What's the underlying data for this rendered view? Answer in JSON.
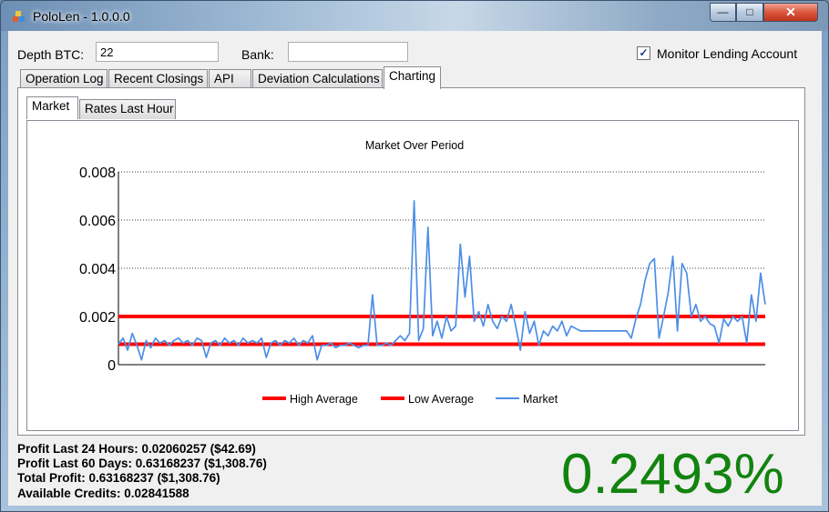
{
  "window": {
    "title": "PoloLen - 1.0.0.0"
  },
  "caption_buttons": {
    "minimize": "—",
    "maximize": "□",
    "close": "✕"
  },
  "form": {
    "depth_label": "Depth BTC:",
    "depth_value": "22",
    "bank_label": "Bank:",
    "bank_value": "",
    "monitor_label": "Monitor Lending Account",
    "monitor_checked": true
  },
  "tabs": [
    "Operation Log",
    "Recent Closings",
    "API",
    "Deviation Calculations",
    "Charting"
  ],
  "active_tab": "Charting",
  "subtabs": [
    "Market",
    "Rates Last Hour"
  ],
  "active_subtab": "Market",
  "chart_data": {
    "type": "line",
    "title": "Market Over Period",
    "xlabel": "",
    "ylabel": "",
    "ylim": [
      0,
      0.008
    ],
    "yticks": [
      "0.008",
      "0.006",
      "0.004",
      "0.002",
      "0"
    ],
    "grid": "horizontal dotted",
    "legend_position": "bottom",
    "series": [
      {
        "name": "High Average",
        "color": "#ff0000",
        "values": [
          0.002,
          0.002
        ]
      },
      {
        "name": "Low Average",
        "color": "#ff0000",
        "values": [
          0.00085,
          0.00085
        ]
      },
      {
        "name": "Market",
        "color": "#4d8ee6",
        "values": [
          0.00085,
          0.0011,
          0.0006,
          0.0013,
          0.0008,
          0.0002,
          0.001,
          0.0007,
          0.0011,
          0.0009,
          0.001,
          0.0008,
          0.001,
          0.0011,
          0.0009,
          0.001,
          0.0008,
          0.0011,
          0.001,
          0.0003,
          0.0009,
          0.001,
          0.0008,
          0.0011,
          0.0009,
          0.001,
          0.0008,
          0.0011,
          0.0009,
          0.001,
          0.0009,
          0.0011,
          0.0003,
          0.0009,
          0.001,
          0.0008,
          0.001,
          0.0009,
          0.0011,
          0.0008,
          0.001,
          0.0009,
          0.0012,
          0.0002,
          0.0008,
          0.0008,
          0.0009,
          0.0007,
          0.0008,
          0.0008,
          0.0009,
          0.0008,
          0.0007,
          0.0008,
          0.0008,
          0.0029,
          0.0008,
          0.0008,
          0.0009,
          0.0008,
          0.001,
          0.0012,
          0.001,
          0.0013,
          0.0068,
          0.001,
          0.0015,
          0.0057,
          0.0012,
          0.0018,
          0.0011,
          0.002,
          0.0014,
          0.0016,
          0.005,
          0.0028,
          0.0045,
          0.0018,
          0.0022,
          0.0016,
          0.0025,
          0.0018,
          0.0015,
          0.002,
          0.0018,
          0.0025,
          0.0016,
          0.0006,
          0.0022,
          0.0013,
          0.0018,
          0.0008,
          0.0014,
          0.0012,
          0.0016,
          0.0014,
          0.0018,
          0.0012,
          0.0016,
          0.0015,
          0.0014,
          0.0014,
          0.0014,
          0.0014,
          0.0014,
          0.0014,
          0.0014,
          0.0014,
          0.0014,
          0.0014,
          0.0014,
          0.0011,
          0.0019,
          0.0025,
          0.0035,
          0.0042,
          0.0044,
          0.0011,
          0.002,
          0.003,
          0.0045,
          0.0014,
          0.0042,
          0.0038,
          0.002,
          0.0025,
          0.0018,
          0.002,
          0.0017,
          0.0016,
          0.0009,
          0.0019,
          0.0016,
          0.002,
          0.0018,
          0.002,
          0.0009,
          0.0029,
          0.0018,
          0.0038,
          0.0025
        ]
      }
    ]
  },
  "stats": {
    "profit_24h": "Profit Last 24 Hours:  0.02060257 ($42.69)",
    "profit_60d": "Profit Last 60 Days: 0.63168237 ($1,308.76)",
    "total_profit": "Total Profit: 0.63168237 ($1,308.76)",
    "available_credits": "Available Credits:  0.02841588"
  },
  "current_rate": "0.2493%"
}
